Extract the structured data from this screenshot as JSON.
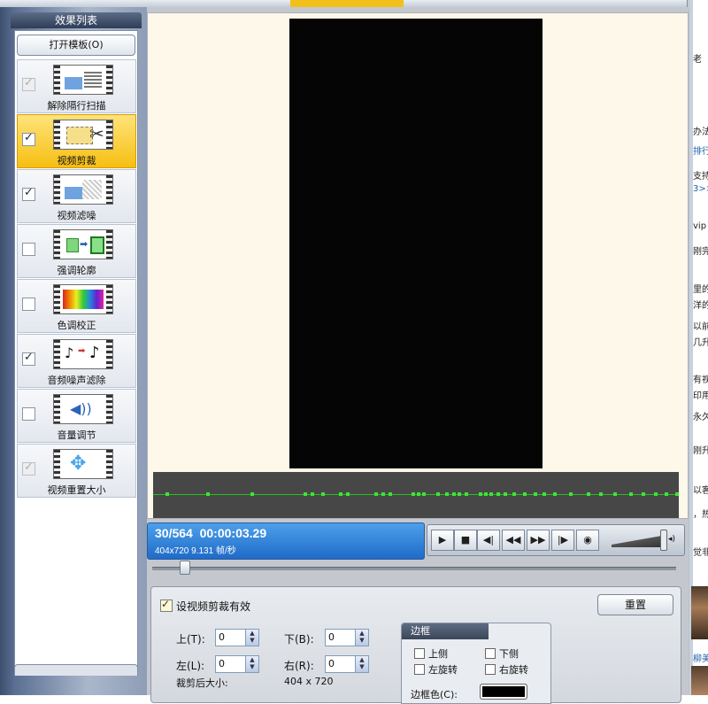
{
  "panel": {
    "title": "效果列表",
    "open_template_label": "打开模板(O)",
    "effects": [
      {
        "label": "解除隔行扫描",
        "checked": true,
        "enabled": false,
        "selected": false,
        "icon": "deinterlace-icon"
      },
      {
        "label": "视频剪裁",
        "checked": true,
        "enabled": true,
        "selected": true,
        "icon": "crop-scissors-icon"
      },
      {
        "label": "视频滤噪",
        "checked": true,
        "enabled": true,
        "selected": false,
        "icon": "video-denoise-icon"
      },
      {
        "label": "强调轮廓",
        "checked": false,
        "enabled": true,
        "selected": false,
        "icon": "sharpen-outline-icon"
      },
      {
        "label": "色调校正",
        "checked": false,
        "enabled": true,
        "selected": false,
        "icon": "color-correction-icon"
      },
      {
        "label": "音频噪声滤除",
        "checked": true,
        "enabled": true,
        "selected": false,
        "icon": "audio-denoise-icon"
      },
      {
        "label": "音量调节",
        "checked": false,
        "enabled": true,
        "selected": false,
        "icon": "volume-adjust-icon"
      },
      {
        "label": "视频重置大小",
        "checked": true,
        "enabled": false,
        "selected": false,
        "icon": "video-resize-icon"
      }
    ]
  },
  "player": {
    "frame_time": "30/564  00:00:03.29",
    "resolution_info": "404x720 9.131 帧/秒",
    "seek_fraction": 0.053,
    "volume_fraction": 0.95,
    "buttons": [
      "play-icon",
      "stop-icon",
      "prev-frame-icon",
      "rewind-icon",
      "fast-forward-icon",
      "next-frame-icon",
      "speaker-icon"
    ]
  },
  "crop_settings": {
    "enable_label": "设视频剪裁有效",
    "enabled": true,
    "reset_label": "重置",
    "top_label": "上(T):",
    "top_value": "0",
    "bottom_label": "下(B):",
    "bottom_value": "0",
    "left_label": "左(L):",
    "left_value": "0",
    "right_label": "右(R):",
    "right_value": "0",
    "crop_size_label": "裁剪后大小:",
    "crop_size_value": "404 x 720"
  },
  "border": {
    "title": "边框",
    "top_side": "上侧",
    "bottom_side": "下侧",
    "rotate_left": "左旋转",
    "rotate_right": "右旋转",
    "color_label": "边框色(C):",
    "color": "#000000"
  },
  "right_strip": {
    "texts": [
      "老",
      "办法",
      "排行",
      "支持",
      "3>>",
      "vip",
      "刚完",
      "里的",
      "洋的",
      "以前",
      "几升",
      "有视",
      "印用",
      "永久",
      "刚升",
      "以客",
      "，热",
      "觉非",
      "柳美"
    ]
  },
  "colors": {
    "selected_effect": "#f6bf12",
    "status_blue": "#2f82d8",
    "timeline_green": "#3ee337",
    "preview_bg": "#fdf8ea"
  }
}
